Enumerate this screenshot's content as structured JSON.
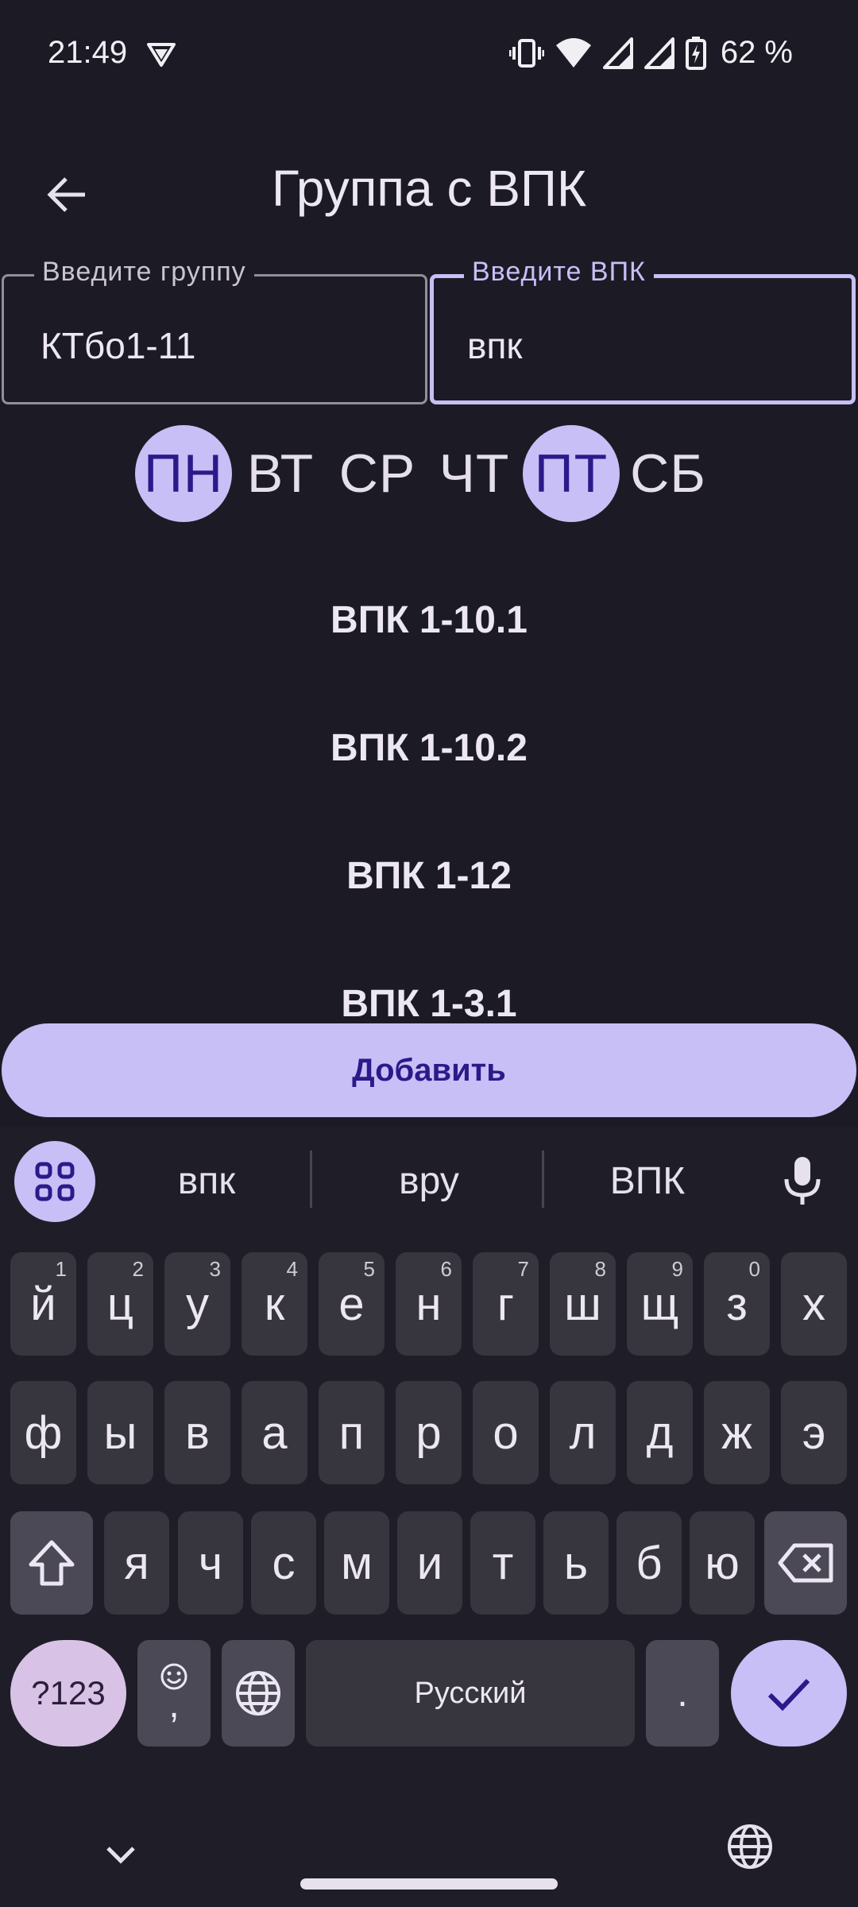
{
  "status_bar": {
    "time": "21:49",
    "battery": "62 %",
    "icons": [
      "vpn-icon",
      "vibrate-icon",
      "wifi-icon",
      "signal-icon",
      "signal-icon",
      "battery-charging-icon"
    ]
  },
  "app_bar": {
    "back_icon": "arrow-left-icon",
    "title": "Группа с ВПК"
  },
  "fields": {
    "group": {
      "label": "Введите группу",
      "value": "КТбо1-11"
    },
    "vpk": {
      "label": "Введите ВПК",
      "value": "впк"
    }
  },
  "days": [
    {
      "label": "ПН",
      "selected": true
    },
    {
      "label": "ВТ",
      "selected": false
    },
    {
      "label": "СР",
      "selected": false
    },
    {
      "label": "ЧТ",
      "selected": false
    },
    {
      "label": "ПТ",
      "selected": true
    },
    {
      "label": "СБ",
      "selected": false
    }
  ],
  "vpk_list": [
    "ВПК 1-10.1",
    "ВПК 1-10.2",
    "ВПК 1-12",
    "ВПК 1-3.1"
  ],
  "add_button": "Добавить",
  "keyboard": {
    "suggestions": [
      "впк",
      "вру",
      "ВПК"
    ],
    "row1": [
      {
        "k": "й",
        "h": "1"
      },
      {
        "k": "ц",
        "h": "2"
      },
      {
        "k": "у",
        "h": "3"
      },
      {
        "k": "к",
        "h": "4"
      },
      {
        "k": "е",
        "h": "5"
      },
      {
        "k": "н",
        "h": "6"
      },
      {
        "k": "г",
        "h": "7"
      },
      {
        "k": "ш",
        "h": "8"
      },
      {
        "k": "щ",
        "h": "9"
      },
      {
        "k": "з",
        "h": "0"
      },
      {
        "k": "х",
        "h": ""
      }
    ],
    "row2": [
      "ф",
      "ы",
      "в",
      "а",
      "п",
      "р",
      "о",
      "л",
      "д",
      "ж",
      "э"
    ],
    "row3": [
      "я",
      "ч",
      "с",
      "м",
      "и",
      "т",
      "ь",
      "б",
      "ю"
    ],
    "symbols_key": "?123",
    "emoji_comma_key": ",",
    "space_label": "Русский",
    "period_key": ".",
    "accent_color": "#c8bff7"
  },
  "colors": {
    "background": "#1c1b25",
    "accent": "#c8bff7",
    "accent_text": "#2b1a8a"
  }
}
